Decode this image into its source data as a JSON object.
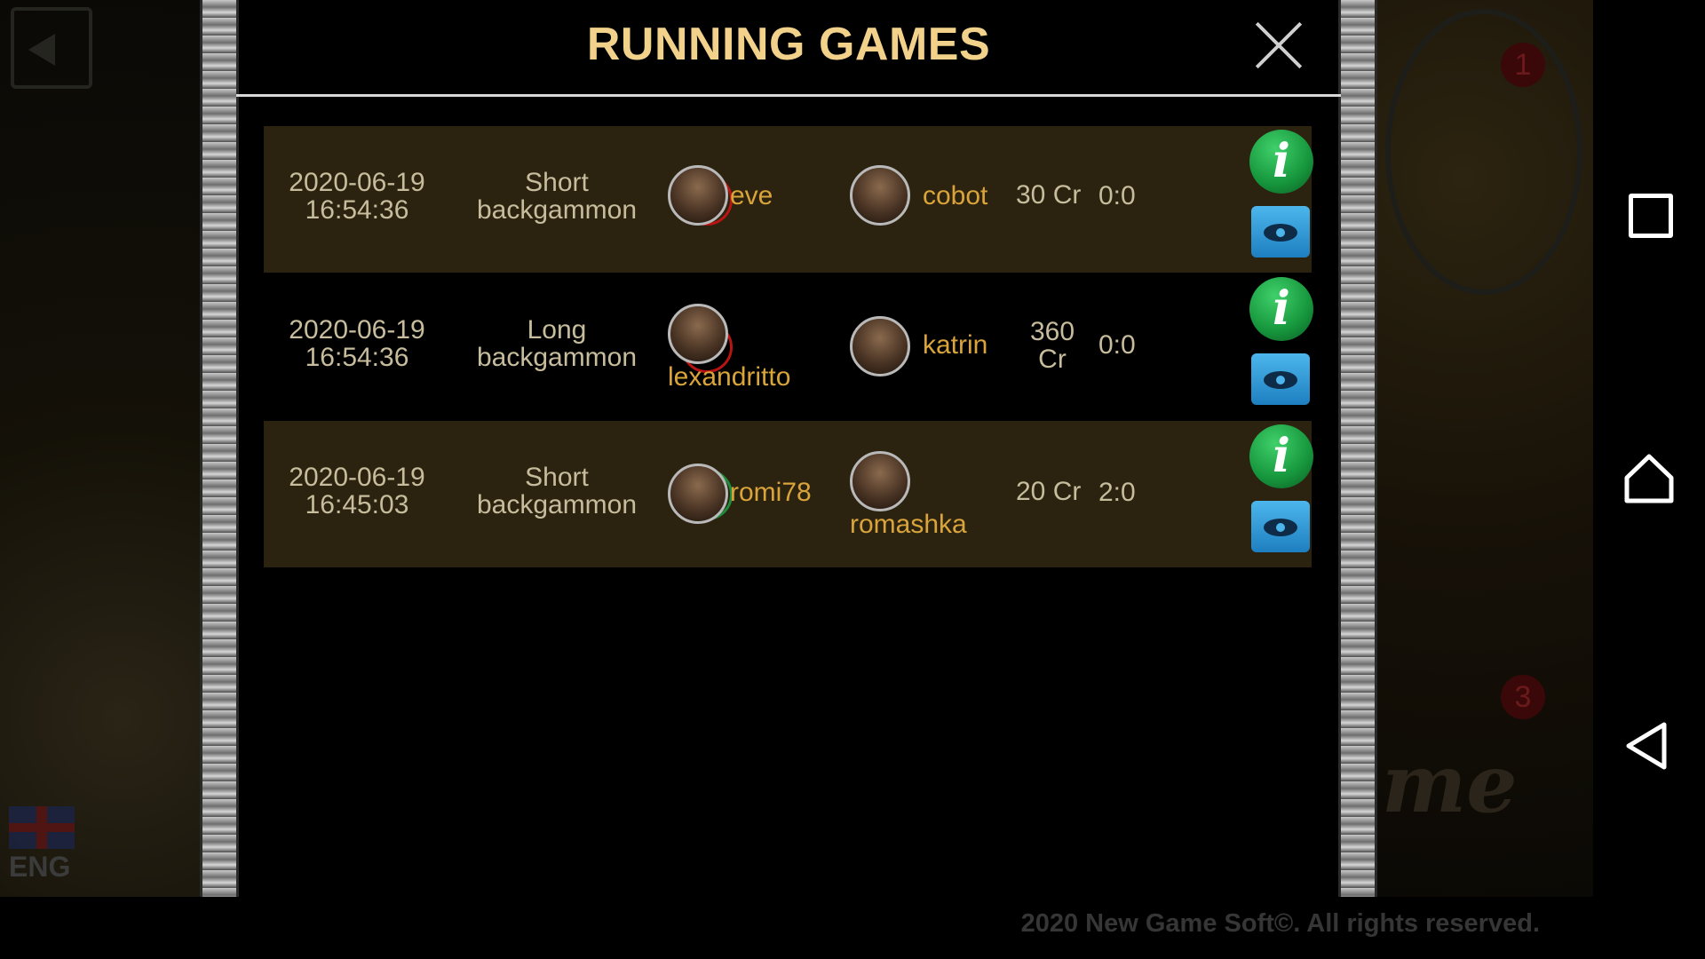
{
  "dialog": {
    "title": "RUNNING GAMES"
  },
  "games": [
    {
      "date": "2020-06-19",
      "time": "16:54:36",
      "type_line1": "Short",
      "type_line2": "backgammon",
      "mode_icon": "running-dog-icon",
      "player1": "eve",
      "player2": "cobot",
      "stake": "30 Cr",
      "score": "0:0"
    },
    {
      "date": "2020-06-19",
      "time": "16:54:36",
      "type_line1": "Long",
      "type_line2": "backgammon",
      "mode_icon": "running-dog-icon",
      "player1": "lexandritto",
      "player2": "katrin",
      "stake": "360 Cr",
      "score": "0:0"
    },
    {
      "date": "2020-06-19",
      "time": "16:45:03",
      "type_line1": "Short",
      "type_line2": "backgammon",
      "mode_icon": "walking-man-icon",
      "player1": "romi78",
      "player2": "romashka",
      "stake": "20 Cr",
      "score": "2:0"
    }
  ],
  "language": "ENG",
  "footer": {
    "copyright": "2020 New Game Soft©. All rights reserved."
  },
  "colors": {
    "title": "#f2d28b",
    "player_name": "#d9a43a",
    "row_bg": "#2b2210",
    "info_green": "#16953c",
    "view_blue": "#1e7fc0"
  }
}
